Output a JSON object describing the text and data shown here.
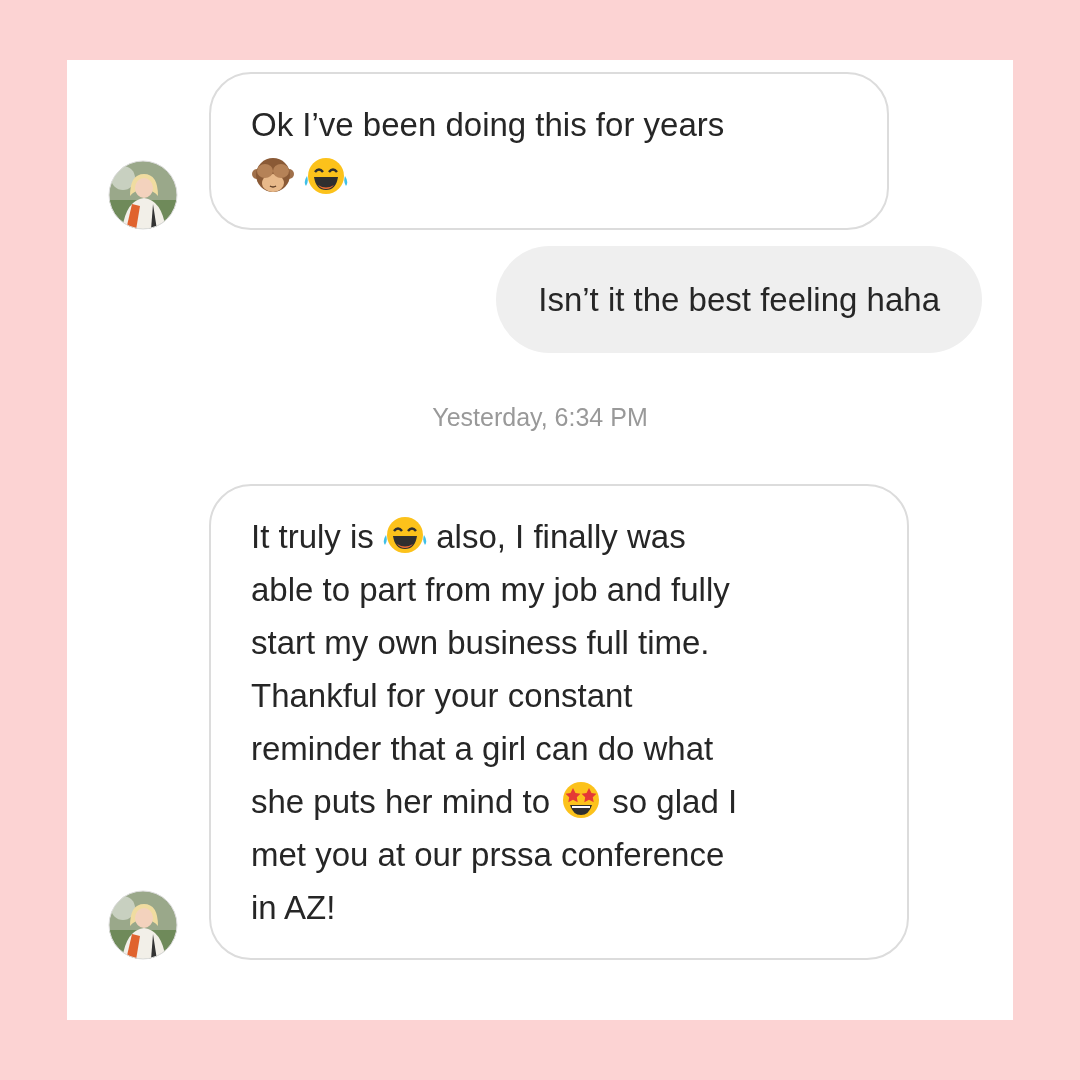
{
  "messages": [
    {
      "kind": "received",
      "lines": [
        [
          {
            "kind": "text",
            "text": "Ok I’ve been doing this for years"
          }
        ],
        [
          {
            "kind": "monkey"
          },
          {
            "kind": "laugh"
          }
        ]
      ]
    },
    {
      "kind": "sent",
      "lines": [
        [
          {
            "kind": "text",
            "text": "Isn’t it the best feeling haha"
          }
        ]
      ]
    },
    {
      "kind": "timestamp",
      "text": "Yesterday, 6:34 PM"
    },
    {
      "kind": "received",
      "lines": [
        [
          {
            "kind": "text",
            "text": "It truly is"
          },
          {
            "kind": "laugh"
          },
          {
            "kind": "text",
            "text": "also, I finally was"
          }
        ],
        [
          {
            "kind": "text",
            "text": "able to part from my job and fully"
          }
        ],
        [
          {
            "kind": "text",
            "text": "start my own business full time."
          }
        ],
        [
          {
            "kind": "text",
            "text": "Thankful for your constant"
          }
        ],
        [
          {
            "kind": "text",
            "text": "reminder that a girl can do what"
          }
        ],
        [
          {
            "kind": "text",
            "text": "she puts her mind to"
          },
          {
            "kind": "starstruck"
          },
          {
            "kind": "text",
            "text": "so glad I"
          }
        ],
        [
          {
            "kind": "text",
            "text": "met you at our prssa conference"
          }
        ],
        [
          {
            "kind": "text",
            "text": "in AZ!"
          }
        ]
      ]
    }
  ]
}
